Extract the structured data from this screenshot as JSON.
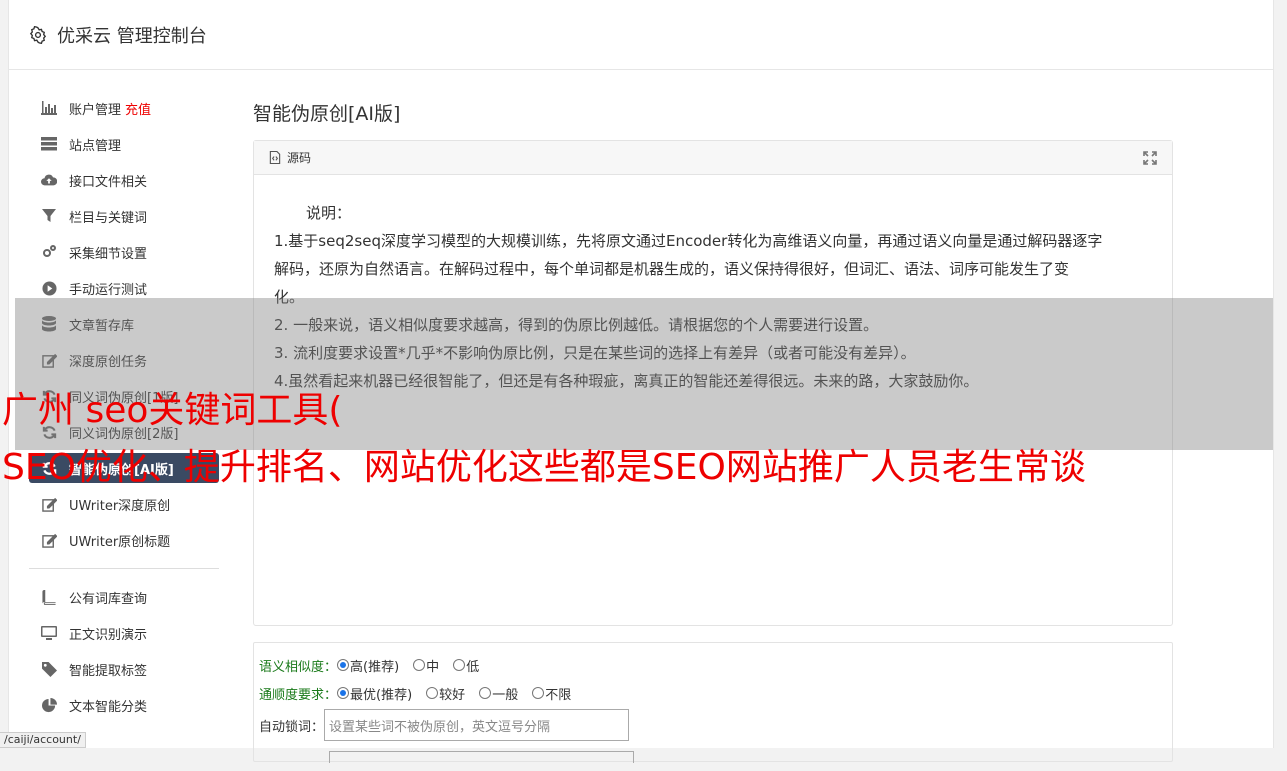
{
  "header": {
    "title": "优采云 管理控制台",
    "icon": "gear-icon"
  },
  "sidebar": {
    "items": [
      {
        "label": "账户管理",
        "badge": "充值",
        "icon": "bar-chart-icon"
      },
      {
        "label": "站点管理",
        "icon": "server-icon"
      },
      {
        "label": "接口文件相关",
        "icon": "cloud-upload-icon"
      },
      {
        "label": "栏目与关键词",
        "icon": "filter-icon"
      },
      {
        "label": "采集细节设置",
        "icon": "cogs-icon"
      },
      {
        "label": "手动运行测试",
        "icon": "play-circle-icon"
      },
      {
        "label": "文章暂存库",
        "icon": "database-icon"
      },
      {
        "label": "深度原创任务",
        "icon": "edit-icon"
      },
      {
        "label": "同义词伪原创[1版]",
        "icon": "refresh-icon"
      },
      {
        "label": "同义词伪原创[2版]",
        "icon": "refresh-icon"
      },
      {
        "label": "智能伪原创[AI版]",
        "icon": "refresh-icon",
        "active": true
      },
      {
        "label": "UWriter深度原创",
        "icon": "edit-icon"
      },
      {
        "label": "UWriter原创标题",
        "icon": "edit-icon"
      }
    ],
    "items2": [
      {
        "label": "公有词库查询",
        "icon": "book-icon"
      },
      {
        "label": "正文识别演示",
        "icon": "monitor-icon"
      },
      {
        "label": "智能提取标签",
        "icon": "tag-icon"
      },
      {
        "label": "文本智能分类",
        "icon": "pie-chart-icon"
      }
    ]
  },
  "main": {
    "title": "智能伪原创[AI版]",
    "source_panel": {
      "label": "源码",
      "lines": [
        "说明：",
        "1.基于seq2seq深度学习模型的大规模训练，先将原文通过Encoder转化为高维语义向量，再通过语义向量是通过解码器逐字",
        "解码，还原为自然语言。在解码过程中，每个单词都是机器生成的，语义保持得很好，但词汇、语法、词序可能发生了变",
        "化。",
        "2. 一般来说，语义相似度要求越高，得到的伪原比例越低。请根据您的个人需要进行设置。",
        "3. 流利度要求设置*几乎*不影响伪原比例，只是在某些词的选择上有差异（或者可能没有差异）。",
        "4.虽然看起来机器已经很智能了，但还是有各种瑕疵，离真正的智能还差得很远。未来的路，大家鼓励你。"
      ]
    },
    "options": {
      "similarity": {
        "label": "语义相似度：",
        "choices": [
          "高(推荐)",
          "中",
          "低"
        ],
        "selected": "高(推荐)"
      },
      "fluency": {
        "label": "通顺度要求：",
        "choices": [
          "最优(推荐)",
          "较好",
          "一般",
          "不限"
        ],
        "selected": "最优(推荐)"
      },
      "lock": {
        "label": "自动锁词：",
        "placeholder": "设置某些词不被伪原创，英文逗号分隔"
      }
    }
  },
  "overlay": {
    "headline1": "广州 seo关键词工具(",
    "headline2": "SEO优化、提升排名、网站优化这些都是SEO网站推广人员老生常谈"
  },
  "status_bar": {
    "url": "/caiji/account/"
  },
  "colors": {
    "active_bg": "#3a4a63",
    "badge": "#ee0000",
    "option_label": "#1a7a1a",
    "overlay_text": "#ee0000"
  }
}
